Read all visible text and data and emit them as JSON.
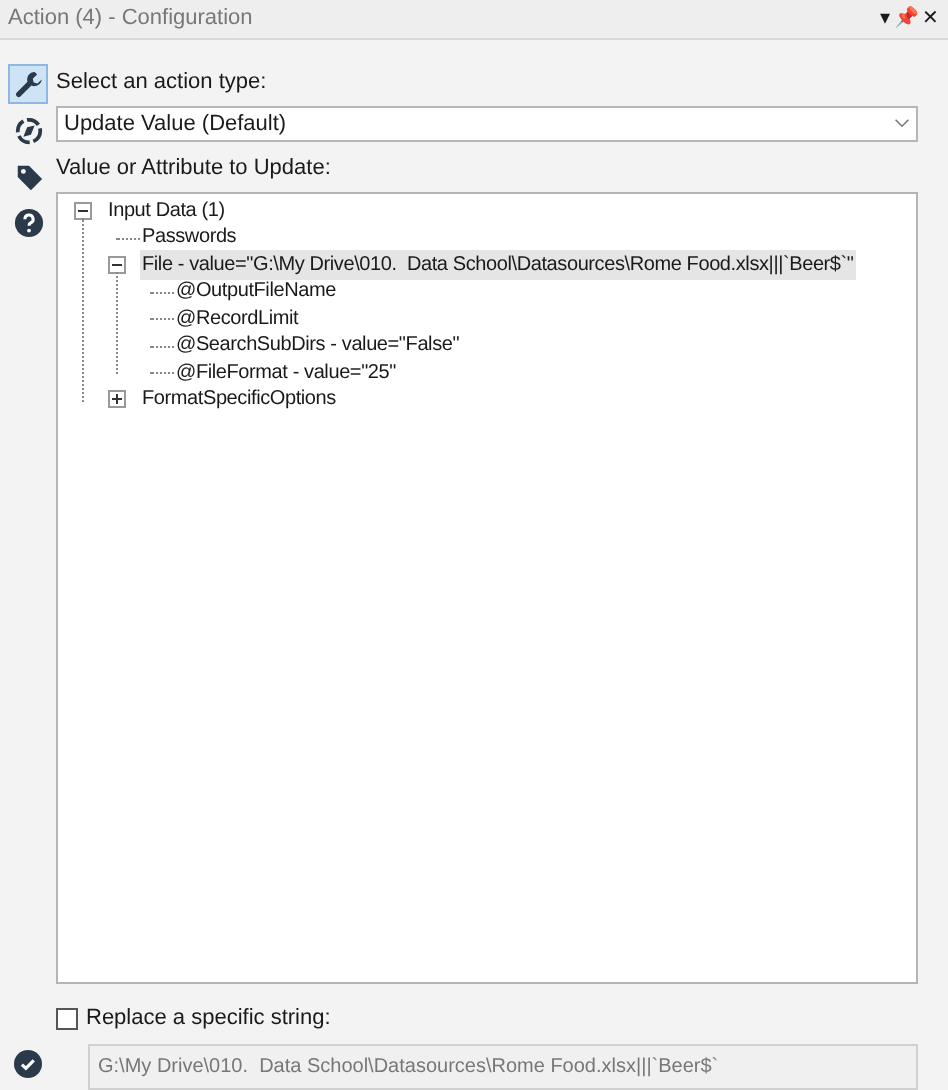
{
  "window": {
    "title": "Action (4) - Configuration",
    "controls": [
      "▾",
      "📌",
      "✕"
    ]
  },
  "sidebar": {
    "items": [
      {
        "kind": "wrench",
        "selected": true
      },
      {
        "kind": "compass",
        "selected": false
      },
      {
        "kind": "tag",
        "selected": false
      },
      {
        "kind": "help",
        "selected": false
      }
    ]
  },
  "action_type": {
    "label": "Select an action type:",
    "value": "Update Value (Default)"
  },
  "tree_label": "Value or Attribute to Update:",
  "tree": [
    {
      "label": "Input Data (1)",
      "expanded": true,
      "selected": false,
      "children": [
        {
          "label": "Passwords",
          "selected": false
        },
        {
          "label": "File - value=\"G:\\My Drive\\010.  Data School\\Datasources\\Rome Food.xlsx|||`Beer$`\"",
          "expanded": true,
          "selected": true,
          "children": [
            {
              "label": "@OutputFileName",
              "selected": false
            },
            {
              "label": "@RecordLimit",
              "selected": false
            },
            {
              "label": "@SearchSubDirs - value=\"False\"",
              "selected": false
            },
            {
              "label": "@FileFormat - value=\"25\"",
              "selected": false
            }
          ]
        },
        {
          "label": "FormatSpecificOptions",
          "expanded": false,
          "selected": false
        }
      ]
    }
  ],
  "replace": {
    "label": "Replace a specific string:",
    "checked": false,
    "value": "G:\\My Drive\\010.  Data School\\Datasources\\Rome Food.xlsx|||`Beer$`"
  }
}
